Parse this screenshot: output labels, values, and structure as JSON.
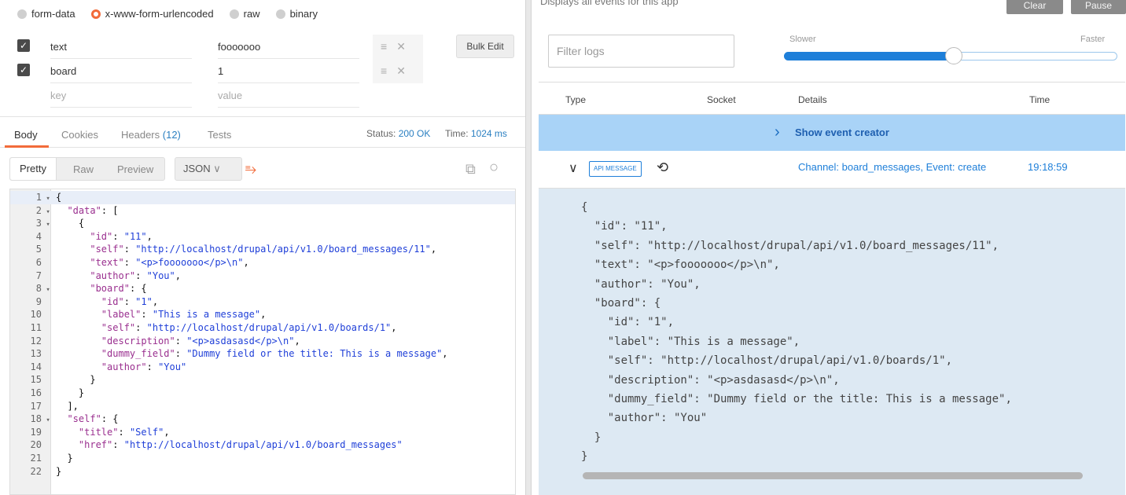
{
  "request": {
    "body_types": [
      {
        "label": "form-data",
        "selected": false
      },
      {
        "label": "x-www-form-urlencoded",
        "selected": true
      },
      {
        "label": "raw",
        "selected": false
      },
      {
        "label": "binary",
        "selected": false
      }
    ],
    "params": [
      {
        "key": "text",
        "value": "fooooooo",
        "checked": true
      },
      {
        "key": "board",
        "value": "1",
        "checked": true
      }
    ],
    "key_placeholder": "key",
    "value_placeholder": "value",
    "bulk_edit_label": "Bulk Edit"
  },
  "response": {
    "tabs": [
      {
        "label": "Body",
        "active": true
      },
      {
        "label": "Cookies"
      },
      {
        "label": "Headers",
        "count": "(12)"
      },
      {
        "label": "Tests"
      }
    ],
    "status_label": "Status:",
    "status_value": "200 OK",
    "time_label": "Time:",
    "time_value": "1024 ms",
    "view_modes": [
      "Pretty",
      "Raw",
      "Preview"
    ],
    "format": "JSON",
    "code": [
      {
        "n": "1",
        "fold": true,
        "text": "{"
      },
      {
        "n": "2",
        "fold": true,
        "text": "  \"data\": ["
      },
      {
        "n": "3",
        "fold": true,
        "text": "    {"
      },
      {
        "n": "4",
        "text": "      \"id\": \"11\","
      },
      {
        "n": "5",
        "text": "      \"self\": \"http://localhost/drupal/api/v1.0/board_messages/11\","
      },
      {
        "n": "6",
        "text": "      \"text\": \"<p>fooooooo</p>\\n\","
      },
      {
        "n": "7",
        "text": "      \"author\": \"You\","
      },
      {
        "n": "8",
        "fold": true,
        "text": "      \"board\": {"
      },
      {
        "n": "9",
        "text": "        \"id\": \"1\","
      },
      {
        "n": "10",
        "text": "        \"label\": \"This is a message\","
      },
      {
        "n": "11",
        "text": "        \"self\": \"http://localhost/drupal/api/v1.0/boards/1\","
      },
      {
        "n": "12",
        "text": "        \"description\": \"<p>asdasasd</p>\\n\","
      },
      {
        "n": "13",
        "text": "        \"dummy_field\": \"Dummy field or the title: This is a message\","
      },
      {
        "n": "14",
        "text": "        \"author\": \"You\""
      },
      {
        "n": "15",
        "text": "      }"
      },
      {
        "n": "16",
        "text": "    }"
      },
      {
        "n": "17",
        "text": "  ],"
      },
      {
        "n": "18",
        "fold": true,
        "text": "  \"self\": {"
      },
      {
        "n": "19",
        "text": "    \"title\": \"Self\","
      },
      {
        "n": "20",
        "text": "    \"href\": \"http://localhost/drupal/api/v1.0/board_messages\""
      },
      {
        "n": "21",
        "text": "  }"
      },
      {
        "n": "22",
        "text": "}"
      }
    ]
  },
  "debug": {
    "cut_title": "Displays all events for this app",
    "clear_label": "Clear",
    "pause_label": "Pause",
    "filter_placeholder": "Filter logs",
    "slower_label": "Slower",
    "faster_label": "Faster",
    "speed_fraction": 0.51,
    "columns": [
      "Type",
      "Socket",
      "Details",
      "Time"
    ],
    "show_creator_label": "Show event creator",
    "event": {
      "badge": "API MESSAGE",
      "details": "Channel: board_messages, Event: create",
      "time": "19:18:59"
    },
    "payload": [
      "{",
      "  \"id\": \"11\",",
      "  \"self\": \"http://localhost/drupal/api/v1.0/board_messages/11\",",
      "  \"text\": \"<p>fooooooo</p>\\n\",",
      "  \"author\": \"You\",",
      "  \"board\": {",
      "    \"id\": \"1\",",
      "    \"label\": \"This is a message\",",
      "    \"self\": \"http://localhost/drupal/api/v1.0/boards/1\",",
      "    \"description\": \"<p>asdasasd</p>\\n\",",
      "    \"dummy_field\": \"Dummy field or the title: This is a message\",",
      "    \"author\": \"You\"",
      "  }",
      "}"
    ]
  },
  "colors": {
    "accent_orange": "#f26b3a",
    "link_blue": "#1e7fd9",
    "creator_bg": "#a9d3f7",
    "payload_bg": "#dde9f3"
  }
}
